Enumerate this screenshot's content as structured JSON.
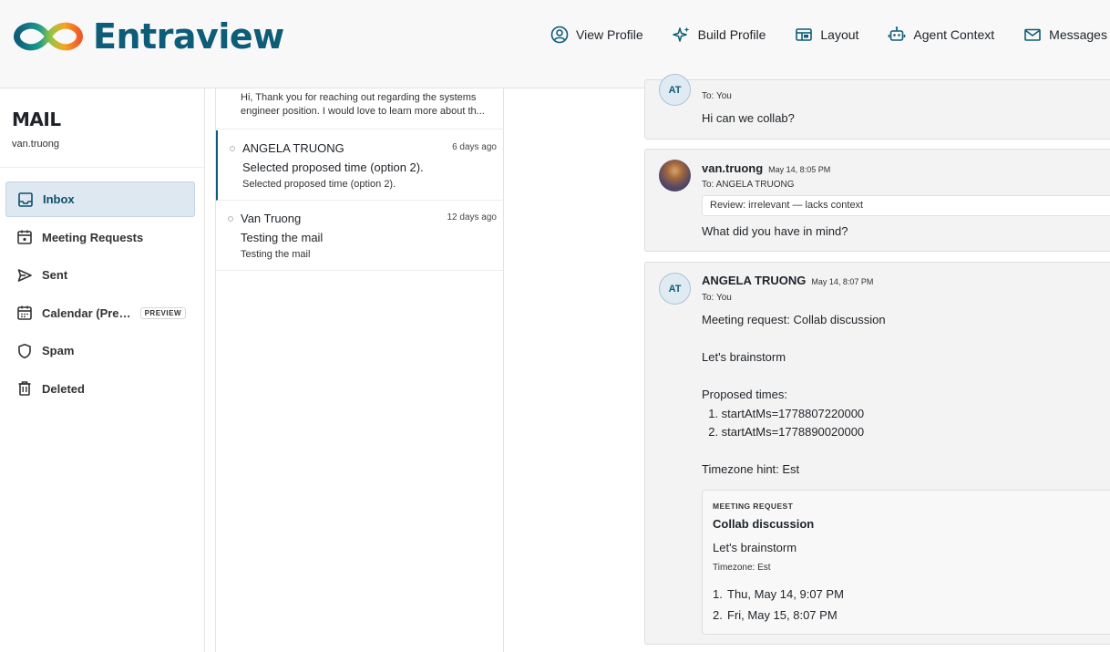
{
  "brand": {
    "name": "Entraview"
  },
  "nav": {
    "view_profile": "View Profile",
    "build_profile": "Build Profile",
    "layout": "Layout",
    "agent_context": "Agent Context",
    "messages": "Messages"
  },
  "sidebar": {
    "title": "MAIL",
    "user": "van.truong",
    "items": [
      {
        "label": "Inbox",
        "icon": "inbox-icon",
        "active": true
      },
      {
        "label": "Meeting Requests",
        "icon": "calendar-plus-icon"
      },
      {
        "label": "Sent",
        "icon": "send-icon"
      },
      {
        "label": "Calendar (Pre…",
        "icon": "calendar-icon",
        "badge": "PREVIEW"
      },
      {
        "label": "Spam",
        "icon": "shield-icon"
      },
      {
        "label": "Deleted",
        "icon": "trash-icon"
      }
    ]
  },
  "message_list": [
    {
      "preview": "Hi, Thank you for reaching out regarding the systems engineer position. I would love to learn more about th..."
    },
    {
      "from": "ANGELA TRUONG",
      "time": "6 days ago",
      "subject": "Selected proposed time (option 2).",
      "preview": "Selected proposed time (option 2)."
    },
    {
      "from": "Van Truong",
      "time": "12 days ago",
      "subject": "Testing the mail",
      "preview": "Testing the mail"
    }
  ],
  "thread": [
    {
      "initials": "AT",
      "to": "To: You",
      "body": "Hi can we collab?"
    },
    {
      "from": "van.truong",
      "date": "May 14, 8:05 PM",
      "to": "To: ANGELA TRUONG",
      "review": "Review: irrelevant — lacks context",
      "body": "What did you have in mind?"
    },
    {
      "initials": "AT",
      "from": "ANGELA TRUONG",
      "date": "May 14, 8:07 PM",
      "to": "To: You",
      "body": "Meeting request: Collab discussion\n\nLet's brainstorm\n\nProposed times:\n  1. startAtMs=1778807220000\n  2. startAtMs=1778890020000\n\nTimezone hint: Est",
      "meeting": {
        "label": "MEETING REQUEST",
        "title": "Collab discussion",
        "description": "Let's brainstorm",
        "timezone": "Timezone: Est",
        "options": [
          {
            "num": "1.",
            "text": "Thu, May 14, 9:07 PM"
          },
          {
            "num": "2.",
            "text": "Fri, May 15, 8:07 PM"
          }
        ]
      }
    }
  ]
}
